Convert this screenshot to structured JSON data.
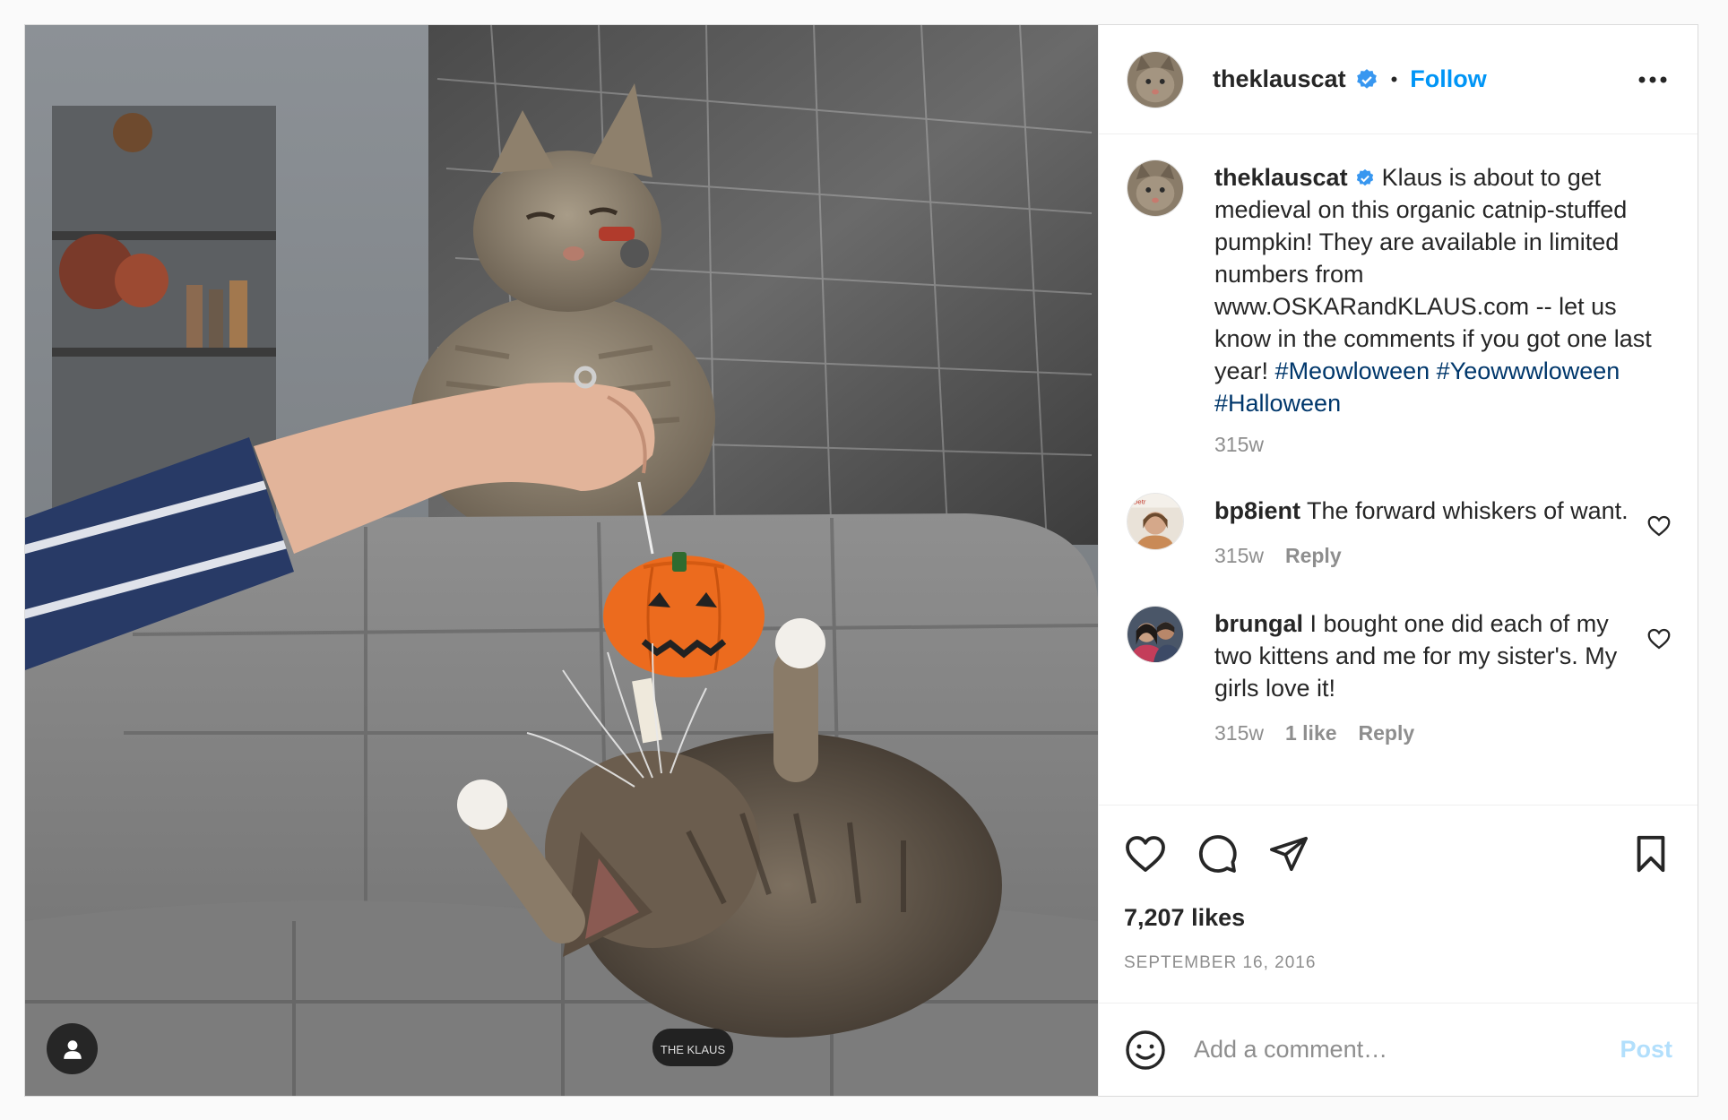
{
  "post": {
    "author": {
      "username": "theklauscat",
      "verified": true,
      "follow_label": "Follow",
      "separator": "•"
    },
    "photo": {
      "pumpkin_tag_text": "THE KLAUS"
    },
    "caption": {
      "username": "theklauscat",
      "text": "Klaus is about to get medieval on this organic catnip-stuffed pumpkin! They are available in limited numbers from www.OSKARandKLAUS.com -- let us know in the comments if you got one last year!",
      "hashtags": [
        "#Meowloween",
        "#Yeowwwloween",
        "#Halloween"
      ],
      "time": "315w"
    },
    "comments": [
      {
        "username": "bp8ient",
        "text": "The forward whiskers of want.",
        "time": "315w",
        "likes": "",
        "reply_label": "Reply"
      },
      {
        "username": "brungal",
        "text": "I bought one did each of my two kittens and me for my sister's. My girls love it!",
        "time": "315w",
        "likes": "1 like",
        "reply_label": "Reply"
      }
    ],
    "likes_count": "7,207 likes",
    "date": "SEPTEMBER 16, 2016",
    "comment_box": {
      "placeholder": "Add a comment…",
      "post_label": "Post"
    },
    "colors": {
      "accent": "#0095f6",
      "hashtag": "#00376b",
      "verified": "#3897f0",
      "muted": "#8e8e8e"
    },
    "icons": [
      "more-options-icon",
      "like-icon",
      "comment-icon",
      "share-icon",
      "save-icon",
      "emoji-icon",
      "comment-like-icon",
      "verified-badge-icon",
      "user-tag-icon"
    ]
  }
}
